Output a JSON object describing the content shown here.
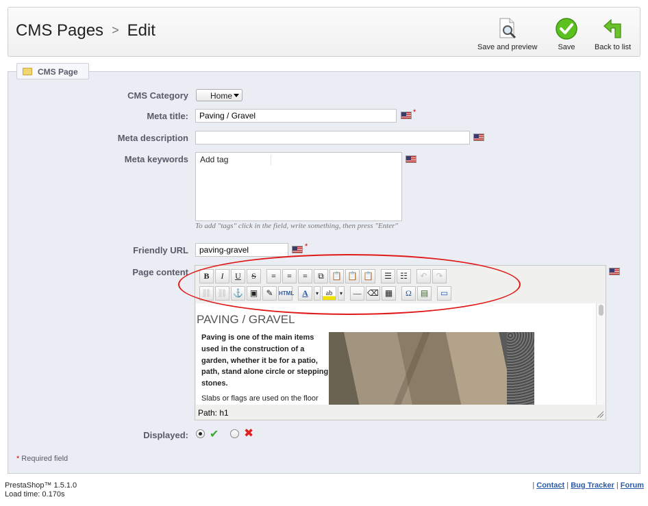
{
  "header": {
    "breadcrumb": [
      "CMS Pages",
      "Edit"
    ],
    "breadcrumb_sep": ">",
    "toolbar": [
      {
        "label": "Save and preview",
        "icon": "magnifier-document-icon"
      },
      {
        "label": "Save",
        "icon": "green-check-icon"
      },
      {
        "label": "Back to list",
        "icon": "green-return-arrow-icon"
      }
    ]
  },
  "fieldset": {
    "legend": "CMS Page"
  },
  "form": {
    "category": {
      "label": "CMS Category",
      "value": "Home"
    },
    "meta_title": {
      "label": "Meta title:",
      "value": "Paving / Gravel",
      "required": "*"
    },
    "meta_description": {
      "label": "Meta description",
      "value": ""
    },
    "meta_keywords": {
      "label": "Meta keywords",
      "tag_placeholder": "Add tag",
      "hint": "To add \"tags\" click in the field, write something, then press \"Enter\""
    },
    "friendly_url": {
      "label": "Friendly URL",
      "value": "paving-gravel",
      "required": "*"
    },
    "page_content": {
      "label": "Page content"
    },
    "displayed": {
      "label": "Displayed:",
      "value": "yes",
      "yes_icon": "green-check-icon",
      "no_icon": "red-x-icon"
    }
  },
  "editor": {
    "row1": [
      "B",
      "I",
      "U",
      "S",
      "≡",
      "≡",
      "≡",
      "⧉",
      "📋",
      "📋",
      "📋",
      "☰",
      "☷",
      "↶",
      "↷"
    ],
    "row2": [
      "⛓",
      "⛓",
      "⚓",
      "▣",
      "✎",
      "HTML",
      "A",
      "▾",
      "ab",
      "▾",
      "—",
      "⌫",
      "▦",
      "Ω",
      "▤",
      "▭"
    ],
    "heading": "PAVING / GRAVEL",
    "paragraph1": "Paving is one of the main items used in the construction of a garden, whether it be for a patio, path, stand alone circle or stepping stones.",
    "paragraph2": "Slabs or flags are used on the floor",
    "path": "Path: h1"
  },
  "required_note": "Required field",
  "required_star": "*",
  "footer": {
    "version": "PrestaShop™ 1.5.1.0",
    "load_time": "Load time: 0.170s",
    "links": [
      "Contact",
      "Bug Tracker",
      "Forum"
    ],
    "sep": "|"
  },
  "colors": {
    "accent_red": "#e01818",
    "link": "#2a5aa7",
    "panel": "#ebedf4"
  }
}
